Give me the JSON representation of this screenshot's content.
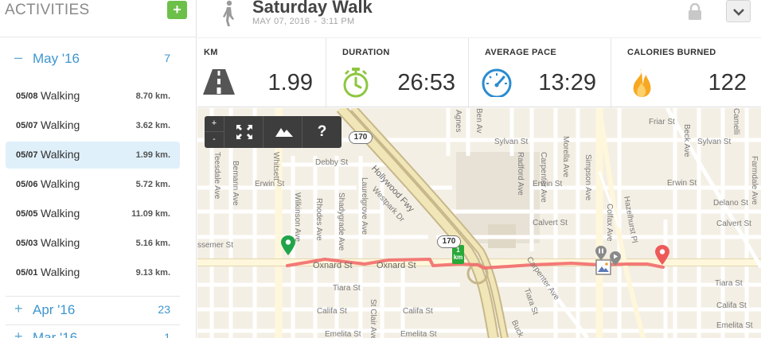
{
  "sidebar": {
    "title": "ACTIVITIES",
    "add_label": "+",
    "months": [
      {
        "sign": "–",
        "label": "May '16",
        "count": "7"
      },
      {
        "sign": "+",
        "label": "Apr '16",
        "count": "23"
      },
      {
        "sign": "+",
        "label": "Mar '16",
        "count": "1"
      }
    ],
    "activities": [
      {
        "date": "05/08",
        "type": "Walking",
        "distance": "8.70 km."
      },
      {
        "date": "05/07",
        "type": "Walking",
        "distance": "3.62 km."
      },
      {
        "date": "05/07",
        "type": "Walking",
        "distance": "1.99 km.",
        "selected": true
      },
      {
        "date": "05/06",
        "type": "Walking",
        "distance": "5.72 km."
      },
      {
        "date": "05/05",
        "type": "Walking",
        "distance": "11.09 km."
      },
      {
        "date": "05/03",
        "type": "Walking",
        "distance": "5.16 km."
      },
      {
        "date": "05/01",
        "type": "Walking",
        "distance": "9.13 km."
      }
    ]
  },
  "header": {
    "title": "Saturday Walk",
    "date": "MAY 07, 2016",
    "separator": "-",
    "time": "3:11 PM"
  },
  "stats": [
    {
      "label": "KM",
      "value": "1.99",
      "icon": "road-icon"
    },
    {
      "label": "DURATION",
      "value": "26:53",
      "icon": "stopwatch-icon"
    },
    {
      "label": "AVERAGE PACE",
      "value": "13:29",
      "icon": "speedometer-icon"
    },
    {
      "label": "CALORIES BURNED",
      "value": "122",
      "icon": "flame-icon"
    }
  ],
  "map": {
    "zoom_in": "+",
    "zoom_out": "-",
    "help": "?",
    "km_marker": {
      "number": "1",
      "unit": "km"
    },
    "shields": [
      "170",
      "170"
    ],
    "streets": {
      "debby": "Debby St",
      "erwin1": "Erwin St",
      "erwin2": "Erwin St",
      "erwin3": "Erwin St",
      "hollywood": "Hollywood Fwy",
      "westpark": "Westpark Dr",
      "oxnard1": "Oxnard St",
      "oxnard2": "Oxnard St",
      "tiara1": "Tiara St",
      "tiara2": "Tiara St",
      "califa1": "Califa St",
      "califa2": "Califa St",
      "emelita1": "Emelita St",
      "emelita2": "Emelita St",
      "sylvan1": "Sylvan St",
      "sylvan2": "Sylvan St",
      "friar": "Friar St",
      "calvert1": "Calvert St",
      "calvert2": "Calvert St",
      "delano": "Delano St",
      "ssemer": "ssemer St",
      "teesdale": "Teesdale Ave",
      "bemann": "Bemann Ave",
      "whitsett": "Whitsett",
      "wilkinson": "Wilkinson Ave",
      "rhodes": "Rhodes Ave",
      "shadygrade": "Shadygrade Ave",
      "laurelgrove": "Laurelgrove Ave",
      "stclair": "St Clair Ave",
      "agnes": "Agnes",
      "ben": "Ben Av",
      "radford": "Radford Ave",
      "carpenter1": "Carpenter Ave",
      "carpenter2": "Carpenter Ave",
      "morella": "Morella Ave",
      "simpson": "Simpson Ave",
      "colfax": "Colfax Ave",
      "hazelhurst": "Hazelhurst Pl",
      "beck": "Beck Ave",
      "camellia": "Camelli",
      "farmdale": "Farmdale Ave",
      "tiara3": "Tiara St",
      "bucki": "Buck"
    }
  }
}
